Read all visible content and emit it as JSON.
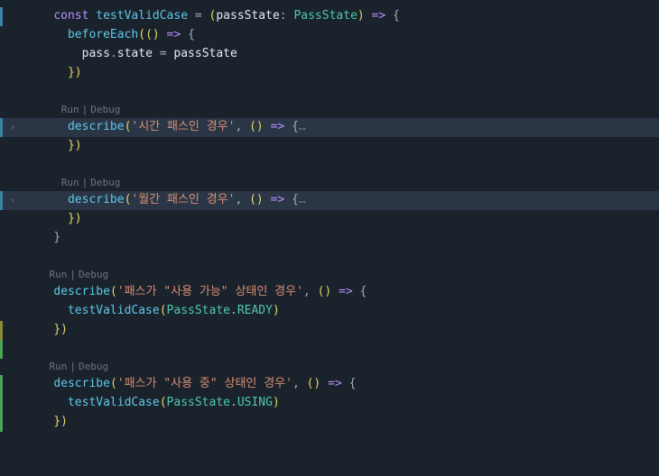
{
  "codelens": {
    "run": "Run",
    "debug": "Debug"
  },
  "code": {
    "const": "const",
    "testValidCase": "testValidCase",
    "eq": " = ",
    "open_pg": "(",
    "passState_param": "passState",
    "colon": ": ",
    "PassState": "PassState",
    "close_pg": ")",
    "arrow": " => ",
    "lbrace": "{",
    "rbrace": "}",
    "beforeEach": "beforeEach",
    "empty_parens": "(()",
    "pass": "pass",
    "dot": ".",
    "state": "state",
    "assign": " = ",
    "passState_var": "passState",
    "rbrace_paren": "})",
    "describe": "describe",
    "str1": "'시간 패스인 경우'",
    "str2": "'월간 패스인 경우'",
    "str3": "'패스가 \"사용 가능\" 상태인 경우'",
    "str4": "'패스가 \"사용 중\" 상태인 경우'",
    "comma_sp": ", ",
    "fold_dots": "…",
    "READY": "READY",
    "USING": "USING"
  },
  "indent": {
    "i2": "  ",
    "i3": "    ",
    "i4": "      ",
    "i5": "        "
  }
}
